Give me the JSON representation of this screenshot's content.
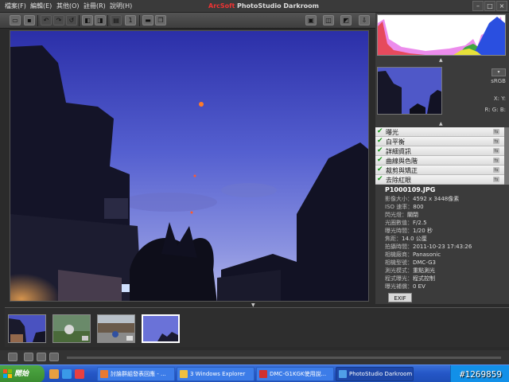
{
  "menu": [
    {
      "label": "檔案(F)"
    },
    {
      "label": "編輯(E)"
    },
    {
      "label": "其他(O)"
    },
    {
      "label": "註冊(R)"
    },
    {
      "label": "說明(H)"
    }
  ],
  "app": {
    "brand": "ArcSoft",
    "product": "PhotoStudio Darkroom"
  },
  "window_controls": [
    "minimize",
    "maximize",
    "close"
  ],
  "toolbar": {
    "icons": [
      "open-icon",
      "save-icon",
      "undo-icon",
      "redo-icon",
      "revert-icon",
      "rotate-left-icon",
      "rotate-right-icon",
      "compare-icon",
      "actual-size-icon",
      "folder-icon",
      "copy-icon",
      "single-view-icon",
      "split-view-icon",
      "before-after-icon",
      "export-icon"
    ]
  },
  "histogram": {
    "colors": [
      "#e53a3a",
      "#2ea82e",
      "#2a4fe0",
      "#e6e03a",
      "#e040e0"
    ]
  },
  "info_panel": {
    "zoom_label": "sRGB",
    "x_label": "X:",
    "y_label": "Y:",
    "r_label": "R:",
    "g_label": "G:",
    "b_label": "B:"
  },
  "adjustments": [
    {
      "label": "曝光"
    },
    {
      "label": "白平衡"
    },
    {
      "label": "詳細資訊"
    },
    {
      "label": "曲線與色階"
    },
    {
      "label": "裁剪與矯正"
    },
    {
      "label": "去除紅眼"
    }
  ],
  "file_info": {
    "filename": "P1000109.JPG",
    "rows": [
      {
        "key": "影像大小：",
        "value": "4592 x 3448像素"
      },
      {
        "key": "ISO 速率：",
        "value": "800"
      },
      {
        "key": "閃光燈：",
        "value": "關閉"
      },
      {
        "key": "光圈數值：",
        "value": "F/2.5"
      },
      {
        "key": "曝光時間：",
        "value": "1/20 秒"
      },
      {
        "key": "焦距：",
        "value": "14.0 公厘"
      },
      {
        "key": "拍攝時間：",
        "value": "2011-10-23 17:43:26"
      },
      {
        "key": "相機廠商：",
        "value": "Panasonic"
      },
      {
        "key": "相機型號：",
        "value": "DMC-G3"
      },
      {
        "key": "測光模式：",
        "value": "重點測光"
      },
      {
        "key": "程式曝光：",
        "value": "程式控制"
      },
      {
        "key": "曝光補償：",
        "value": "0 EV"
      }
    ],
    "tab": "EXIF"
  },
  "filmstrip": [
    {
      "name": "dusk-buildings",
      "selected": false
    },
    {
      "name": "garden-scene",
      "selected": false
    },
    {
      "name": "street-scene",
      "selected": false
    },
    {
      "name": "evening-sky",
      "selected": true
    }
  ],
  "taskbar": {
    "start_label": "開始",
    "tasks": [
      {
        "label": "討論群組發表回應 - ...",
        "icon": "firefox-icon",
        "active": false
      },
      {
        "label": "3 Windows Explorer",
        "icon": "folder-icon",
        "active": false
      },
      {
        "label": "DMC-G1KGK使用說...",
        "icon": "pdf-icon",
        "active": false
      },
      {
        "label": "PhotoStudio Darkroom",
        "icon": "photostudio-icon",
        "active": true
      }
    ]
  },
  "watermark": "#1269859"
}
